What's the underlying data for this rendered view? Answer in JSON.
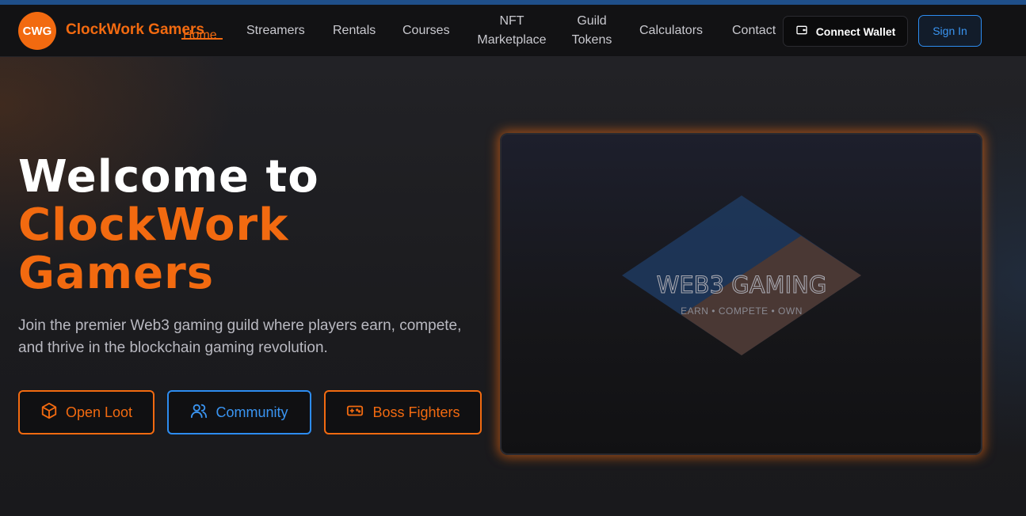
{
  "header": {
    "logo_text": "CWG",
    "brand": "ClockWork Gamers",
    "nav": [
      {
        "label": "Home",
        "active": true
      },
      {
        "label": "Streamers"
      },
      {
        "label": "Rentals"
      },
      {
        "label": "Courses"
      },
      {
        "label_line1": "NFT",
        "label_line2": "Marketplace"
      },
      {
        "label_line1": "Guild",
        "label_line2": "Tokens"
      },
      {
        "label": "Calculators"
      },
      {
        "label": "Contact"
      }
    ],
    "connect_wallet": "Connect Wallet",
    "sign_in": "Sign In"
  },
  "hero": {
    "title_line1": "Welcome to",
    "title_line2": "ClockWork",
    "title_line3": "Gamers",
    "subtitle": "Join the premier Web3 gaming guild where players earn, compete, and thrive in the blockchain gaming revolution.",
    "buttons": [
      {
        "label": "Open Loot",
        "icon": "box-icon"
      },
      {
        "label": "Community",
        "icon": "users-icon"
      },
      {
        "label": "Boss Fighters",
        "icon": "gamepad-icon"
      }
    ]
  },
  "showcase": {
    "title": "WEB3 GAMING",
    "tagline": "EARN • COMPETE • OWN"
  },
  "colors": {
    "accent": "#f26a10",
    "blue": "#2d8cf0",
    "background": "#1b1b1e"
  }
}
